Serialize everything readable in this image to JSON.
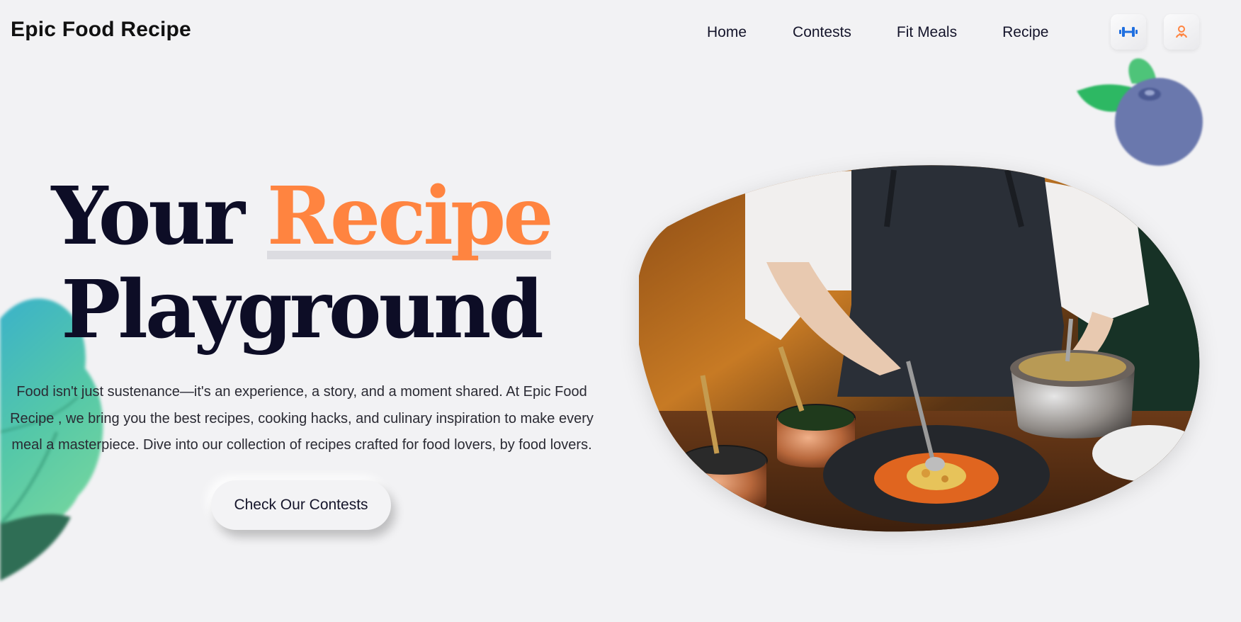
{
  "header": {
    "brand": "Epic Food Recipe",
    "nav": [
      {
        "label": "Home"
      },
      {
        "label": "Contests"
      },
      {
        "label": "Fit Meals"
      },
      {
        "label": "Recipe"
      }
    ],
    "icons": [
      "dumbbell-icon",
      "chef-icon"
    ]
  },
  "hero": {
    "title_part1": "Your",
    "title_accent": "Recipe",
    "title_line2": "Playground",
    "description": "Food isn't just sustenance—it's an experience, a story, and a moment shared. At Epic Food Recipe , we bring you the best recipes, cooking hacks, and culinary inspiration to make every meal a masterpiece. Dive into our collection of recipes crafted for food lovers, by food lovers.",
    "cta_label": "Check Our Contests"
  },
  "colors": {
    "background": "#f2f2f4",
    "accent": "#ff8440",
    "title": "#0d0d26",
    "dumbbell_icon": "#1f6fe0",
    "chef_icon": "#ff8440"
  }
}
